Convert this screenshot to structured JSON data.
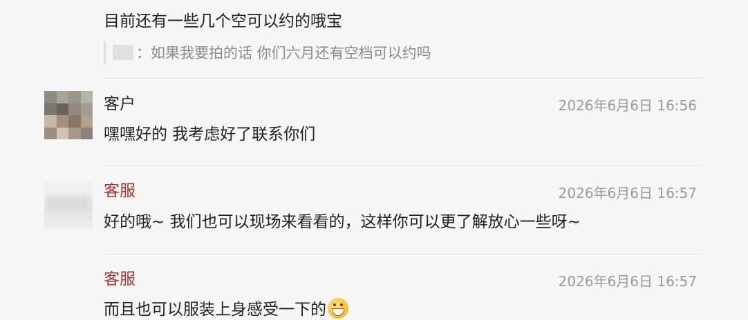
{
  "messages": [
    {
      "text": "目前还有一些几个空可以约的哦宝",
      "quote": {
        "sender": "",
        "separator": "：",
        "text": "如果我要拍的话 你们六月还有空档可以约吗"
      }
    },
    {
      "sender": "客户",
      "time": "2026年6月6日 16:56",
      "text": "嘿嘿好的 我考虑好了联系你们"
    },
    {
      "sender": "客服",
      "time": "2026年6月6日 16:57",
      "text": "好的哦~ 我们也可以现场来看看的，这样你可以更了解放心一些呀~"
    },
    {
      "sender": "客服",
      "time": "2026年6月6日 16:57",
      "text": "而且也可以服装上身感受一下的",
      "emoji": "grinning-face-icon"
    }
  ],
  "colors": {
    "background": "#f6f6f6",
    "service_sender": "#b5322e",
    "timestamp": "#9a9a9a"
  }
}
